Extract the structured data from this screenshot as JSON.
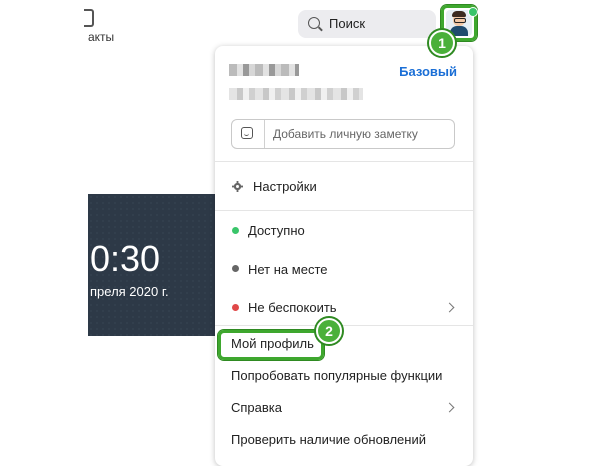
{
  "topbar": {
    "contacts_label": "акты",
    "search_placeholder": "Поиск"
  },
  "clock": {
    "time": "0:30",
    "date": "преля 2020 г."
  },
  "menu": {
    "plan": "Базовый",
    "note_placeholder": "Добавить личную заметку",
    "settings": "Настройки",
    "status_available": "Доступно",
    "status_away": "Нет на месте",
    "status_dnd": "Не беспокоить",
    "my_profile": "Мой профиль",
    "try_features": "Попробовать популярные функции",
    "help": "Справка",
    "check_updates": "Проверить наличие обновлений"
  },
  "badges": {
    "one": "1",
    "two": "2"
  },
  "colors": {
    "accent_blue": "#1b6fd6",
    "available": "#39c56a",
    "away": "#666666",
    "dnd": "#e04848",
    "highlight_green": "#3ea72e"
  }
}
